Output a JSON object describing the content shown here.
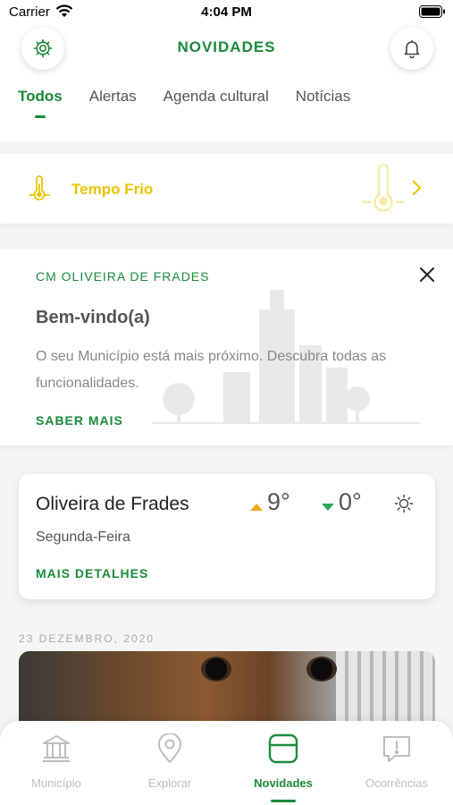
{
  "status_bar": {
    "carrier": "Carrier",
    "time": "4:04 PM"
  },
  "header": {
    "title": "NOVIDADES"
  },
  "tabs": [
    {
      "label": "Todos",
      "active": true
    },
    {
      "label": "Alertas",
      "active": false
    },
    {
      "label": "Agenda cultural",
      "active": false
    },
    {
      "label": "Notícias",
      "active": false
    }
  ],
  "alert": {
    "label": "Tempo Frio",
    "icon": "thermometer-icon",
    "color": "#e9c400"
  },
  "welcome": {
    "source": "CM OLIVEIRA DE FRADES",
    "heading": "Bem-vindo(a)",
    "body": "O seu Município está mais próximo. Descubra todas as funcionalidades.",
    "link": "SABER MAIS"
  },
  "weather": {
    "city": "Oliveira de Frades",
    "day": "Segunda-Feira",
    "max": "9°",
    "min": "0°",
    "condition_icon": "sun-icon",
    "link": "MAIS DETALHES"
  },
  "feed": {
    "date": "23 DEZEMBRO, 2020"
  },
  "bottom_nav": [
    {
      "label": "Município",
      "icon": "building-icon",
      "active": false
    },
    {
      "label": "Explorar",
      "icon": "location-pin-icon",
      "active": false
    },
    {
      "label": "Novidades",
      "icon": "news-icon",
      "active": true
    },
    {
      "label": "Ocorrências",
      "icon": "alert-bubble-icon",
      "active": false
    }
  ],
  "colors": {
    "accent": "#1a8a3a",
    "alert": "#e9c400",
    "max_temp": "#f2a51a",
    "min_temp": "#2faa5a"
  }
}
